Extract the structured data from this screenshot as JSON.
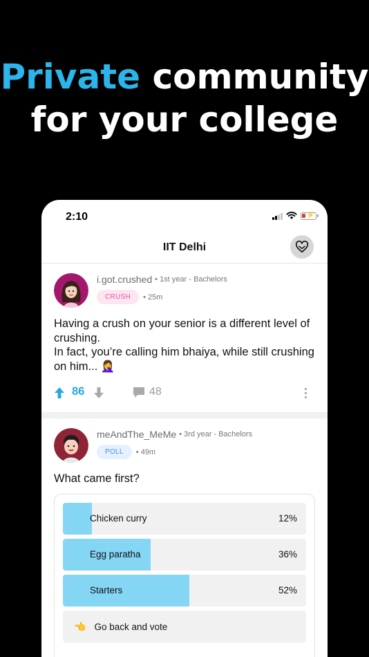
{
  "headline": {
    "accent": "Private",
    "line1_rest": " community",
    "line2": "for your college"
  },
  "status_bar": {
    "time": "2:10"
  },
  "app_bar": {
    "title": "IIT Delhi"
  },
  "posts": [
    {
      "username": "i.got.crushed",
      "subtitle": "• 1st year - Bachelors",
      "tag": "CRUSH",
      "time_ago": "• 25m",
      "text": "Having a crush on your senior is a different level of crushing.\nIn fact, you’re calling him bhaiya, while still crushing on him... 🤦‍♀️",
      "upvotes": "86",
      "comments": "48"
    },
    {
      "username": "meAndThe_MeMe",
      "subtitle": "• 3rd year - Bachelors",
      "tag": "POLL",
      "time_ago": "• 49m",
      "question": "What came first?",
      "options": [
        {
          "label": "Chicken curry",
          "percent": "12%",
          "fraction": 0.12
        },
        {
          "label": "Egg paratha",
          "percent": "36%",
          "fraction": 0.36
        },
        {
          "label": "Starters",
          "percent": "52%",
          "fraction": 0.52
        }
      ],
      "go_back": "Go back and vote",
      "go_back_emoji": "👈"
    }
  ],
  "colors": {
    "accent": "#2bb5ea",
    "upvote": "#29a8e0",
    "poll_fill": "#85d6f5",
    "crush_tag": "#e754a2",
    "poll_tag": "#4a8fe6"
  }
}
